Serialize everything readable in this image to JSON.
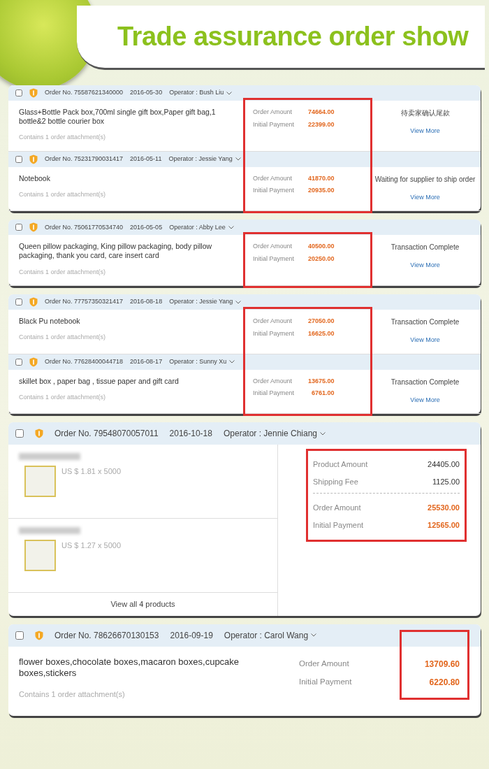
{
  "title": "Trade assurance order show",
  "cards": [
    {
      "kind": "orders",
      "highlighted": true,
      "orders": [
        {
          "checked": false,
          "order_no": "Order No. 75587621340000",
          "date": "2016-05-30",
          "operator": "Operator : Bush Liu",
          "description": "Glass+Bottle Pack box,700ml single gift box,Paper gift bag,1 bottle&2 bottle courier box",
          "attachments": "Contains 1 order attachment(s)",
          "amounts": [
            {
              "label": "Order Amount",
              "value": "74664.00"
            },
            {
              "label": "Initial Payment",
              "value": "22399.00"
            }
          ],
          "status": "待卖家确认尾款",
          "action": "View More"
        },
        {
          "checked": false,
          "order_no": "Order No. 75231790031417",
          "date": "2016-05-11",
          "operator": "Operator : Jessie Yang",
          "description": "Notebook",
          "attachments": "Contains 1 order attachment(s)",
          "amounts": [
            {
              "label": "Order Amount",
              "value": "41870.00"
            },
            {
              "label": "Initial Payment",
              "value": "20935.00"
            }
          ],
          "status": "Waiting for supplier to ship order",
          "action": "View More"
        }
      ]
    },
    {
      "kind": "orders",
      "highlighted": true,
      "orders": [
        {
          "checked": false,
          "order_no": "Order No. 75061770534740",
          "date": "2016-05-05",
          "operator": "Operator : Abby Lee",
          "description": "Queen pillow packaging, King pillow packaging, body pillow packaging, thank you card, care insert card",
          "attachments": "Contains 1 order attachment(s)",
          "amounts": [
            {
              "label": "Order Amount",
              "value": "40500.00"
            },
            {
              "label": "Initial Payment",
              "value": "20250.00"
            }
          ],
          "status": "Transaction Complete",
          "action": "View More"
        }
      ]
    },
    {
      "kind": "orders",
      "highlighted": true,
      "orders": [
        {
          "checked": false,
          "order_no": "Order No. 77757350321417",
          "date": "2016-08-18",
          "operator": "Operator : Jessie Yang",
          "description": "Black Pu notebook",
          "attachments": "Contains 1 order attachment(s)",
          "amounts": [
            {
              "label": "Order Amount",
              "value": "27050.00"
            },
            {
              "label": "Initial Payment",
              "value": "16625.00"
            }
          ],
          "status": "Transaction Complete",
          "action": "View More"
        },
        {
          "checked": false,
          "order_no": "Order No. 77628400044718",
          "date": "2016-08-17",
          "operator": "Operator : Sunny Xu",
          "description": "skillet box , paper bag , tissue paper and gift card",
          "attachments": "Contains 1 order attachment(s)",
          "amounts": [
            {
              "label": "Order Amount",
              "value": "13675.00"
            },
            {
              "label": "Initial Payment",
              "value": "6761.00"
            }
          ],
          "status": "Transaction Complete",
          "action": "View More"
        }
      ]
    },
    {
      "kind": "products",
      "highlighted": true,
      "checked": false,
      "order_no": "Order No. 79548070057011",
      "date": "2016-10-18",
      "operator": "Operator : Jennie Chiang",
      "products": [
        {
          "price": "US $ 1.81 x 5000"
        },
        {
          "price": "US $ 1.27 x 5000"
        }
      ],
      "footer": "View all 4 products",
      "subtotals": [
        {
          "label": "Product Amount",
          "value": "24405.00"
        },
        {
          "label": "Shipping Fee",
          "value": "1125.00"
        }
      ],
      "totals": [
        {
          "label": "Order Amount",
          "value": "25530.00"
        },
        {
          "label": "Initial Payment",
          "value": "12565.00"
        }
      ]
    },
    {
      "kind": "wide",
      "highlighted": true,
      "orders": [
        {
          "checked": false,
          "order_no": "Order No. 78626670130153",
          "date": "2016-09-19",
          "operator": "Operator : Carol Wang",
          "description": "flower boxes,chocolate boxes,macaron boxes,cupcake boxes,stickers",
          "attachments": "Contains 1 order attachment(s)",
          "amounts": [
            {
              "label": "Order Amount",
              "value": "13709.60"
            },
            {
              "label": "Initial Payment",
              "value": "6220.80"
            }
          ]
        }
      ]
    }
  ]
}
